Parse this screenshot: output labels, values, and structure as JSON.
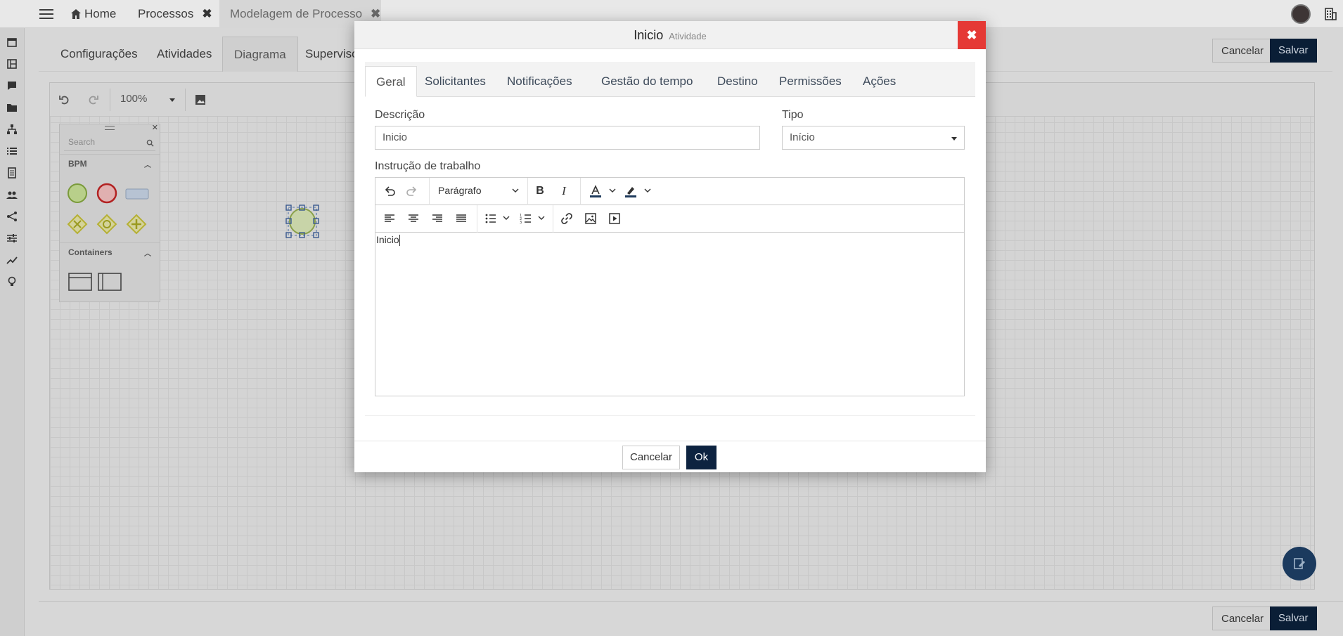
{
  "topbar": {
    "tabs": [
      {
        "label": "Home"
      },
      {
        "label": "Processos"
      },
      {
        "label": "Modelagem de Processo"
      }
    ]
  },
  "page": {
    "subtabs": [
      "Configurações",
      "Atividades",
      "Diagrama",
      "Supervisores"
    ],
    "active_subtab": "Diagrama",
    "cancel_label": "Cancelar",
    "save_label": "Salvar"
  },
  "canvas": {
    "zoom": "100%",
    "palette": {
      "search_placeholder": "Search",
      "section_bpm": "BPM",
      "section_containers": "Containers"
    }
  },
  "modal": {
    "title": "Inicio",
    "subtitle": "Atividade",
    "tabs": [
      "Geral",
      "Solicitantes",
      "Notificações",
      "Gestão do tempo",
      "Destino",
      "Permissões",
      "Ações"
    ],
    "active_tab": "Geral",
    "descricao_label": "Descrição",
    "descricao_value": "Inicio",
    "tipo_label": "Tipo",
    "tipo_value": "Início",
    "instrucao_label": "Instrução de trabalho",
    "editor": {
      "block_format": "Parágrafo",
      "content": "Inicio"
    },
    "cancel_label": "Cancelar",
    "ok_label": "Ok"
  },
  "colors": {
    "primary": "#0d2340",
    "close": "#e53935",
    "start_event": "#8bc34a"
  }
}
